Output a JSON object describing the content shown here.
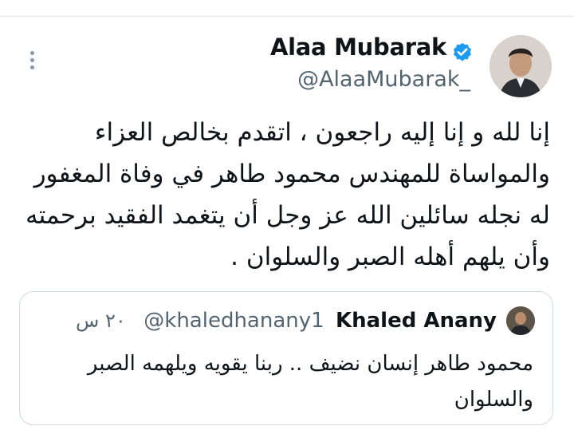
{
  "tweet": {
    "author": {
      "name": "Alaa Mubarak",
      "handle": "@AlaaMubarak_"
    },
    "text": "إنا لله و إنا إليه راجعون ، اتقدم بخالص العزاء والمواساة للمهندس محمود طاهر في وفاة المغفور له نجله سائلين الله عز وجل أن يتغمد الفقيد برحمته وأن يلهم أهله الصبر والسلوان ."
  },
  "quote": {
    "author": {
      "name": "Khaled Anany",
      "handle": "@khaledhanany1"
    },
    "time": "٢٠ س",
    "text": "محمود طاهر إنسان نضيف .. ربنا يقويه ويلهمه الصبر والسلوان"
  },
  "colors": {
    "verified": "#1d9bf0",
    "text": "#0f1419",
    "secondary": "#536471"
  }
}
